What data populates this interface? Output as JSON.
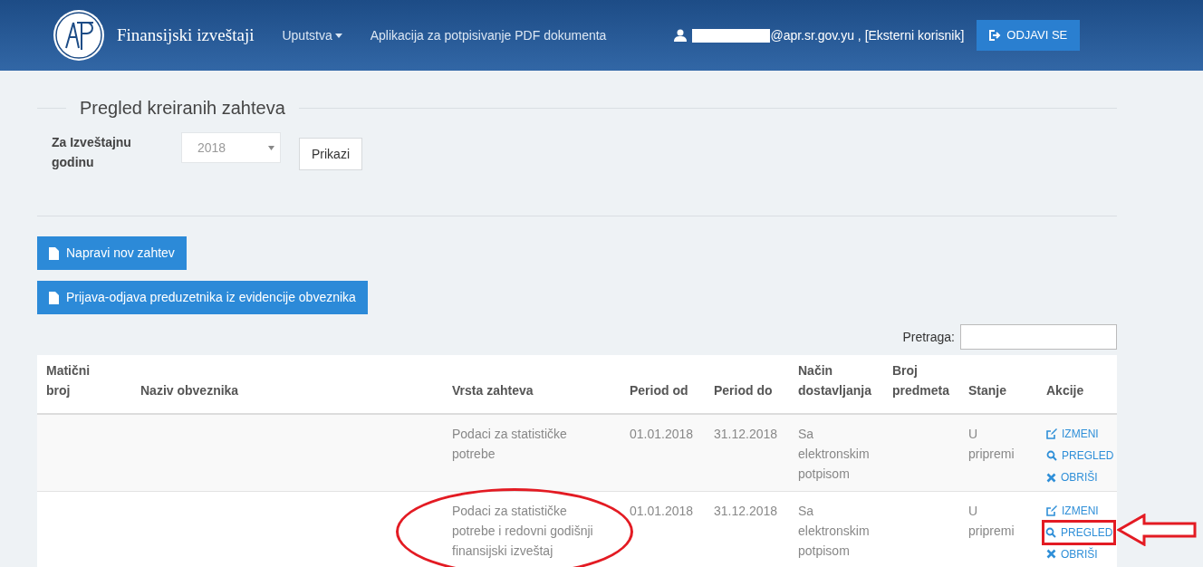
{
  "navbar": {
    "brand": "Finansijski izveštaji",
    "menu": [
      {
        "label": "Uputstva",
        "dropdown": true
      },
      {
        "label": "Aplikacija za potpisivanje PDF dokumenta",
        "dropdown": false
      }
    ],
    "user": "@apr.sr.gov.yu , [Eksterni korisnik]",
    "logout": "ODJAVI SE"
  },
  "section": {
    "title": "Pregled kreiranih zahteva",
    "year_label": "Za Izveštajnu godinu",
    "year_value": "2018",
    "show_button": "Prikazi"
  },
  "buttons": [
    "Napravi nov zahtev",
    "Prijava-odjava preduzetnika iz evidencije obveznika"
  ],
  "search": {
    "label": "Pretraga:"
  },
  "table": {
    "columns": [
      "Matični broj",
      "Naziv obveznika",
      "Vrsta zahteva",
      "Period od",
      "Period do",
      "Način dostavljanja",
      "Broj predmeta",
      "Stanje",
      "Akcije"
    ],
    "rows": [
      {
        "request_type": "Podaci za statističke potrebe",
        "period_from": "01.01.2018",
        "period_to": "31.12.2018",
        "delivery": "Sa elektronskim potpisom",
        "status": "U pripremi",
        "actions": [
          {
            "kind": "edit",
            "label": "IZMENI"
          },
          {
            "kind": "view",
            "label": "PREGLED"
          },
          {
            "kind": "delete",
            "label": "OBRIŠI"
          }
        ],
        "highlighted": false
      },
      {
        "request_type": "Podaci za statističke potrebe i redovni godišnji finansijski izveštaj",
        "period_from": "01.01.2018",
        "period_to": "31.12.2018",
        "delivery": "Sa elektronskim potpisom",
        "status": "U pripremi",
        "actions": [
          {
            "kind": "edit",
            "label": "IZMENI"
          },
          {
            "kind": "view",
            "label": "PREGLED"
          },
          {
            "kind": "delete",
            "label": "OBRIŠI"
          }
        ],
        "highlighted": true
      }
    ]
  }
}
